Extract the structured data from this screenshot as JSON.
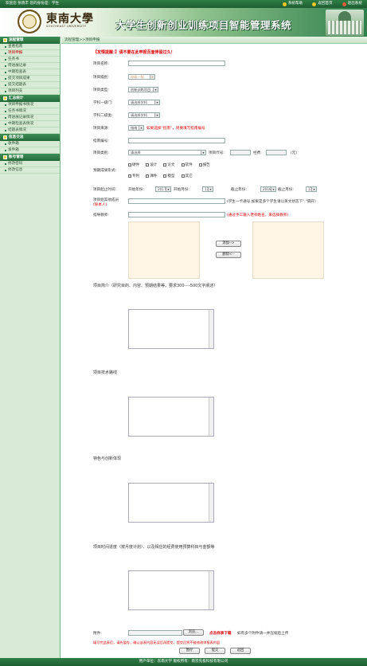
{
  "topbar": {
    "welcome": "欢迎您 张晓丰 您的身份是：学生",
    "links": [
      {
        "label": "系统帮助",
        "icon": "help-icon",
        "color": "#f3c623"
      },
      {
        "label": "返回首页",
        "icon": "home-icon",
        "color": "#f3c623"
      },
      {
        "label": "退出系统",
        "icon": "logout-icon",
        "color": "#f3c623"
      }
    ]
  },
  "banner": {
    "logo_text": "東南大學",
    "logo_sub": "SOUTHEAST UNIVERSITY",
    "title": "大学生创新创业训练项目智能管理系统"
  },
  "sidebar": {
    "sections": [
      {
        "title": "流程管理",
        "items": [
          "查看指南",
          "项目申报",
          "任务书",
          "周进展记录",
          "中期检查表",
          "提交项目成果",
          "提交结题表",
          "项目列支"
        ],
        "active": 1
      },
      {
        "title": "汇总统计",
        "items": [
          "项目申报书情况",
          "任务书情况",
          "周进展记录情况",
          "中期检查表情况",
          "结题表情况"
        ]
      },
      {
        "title": "信息交流",
        "items": [
          "收件箱",
          "发件箱"
        ]
      },
      {
        "title": "账号管理",
        "items": [
          "修改密码",
          "修改信息"
        ]
      }
    ]
  },
  "breadcrumb": "流程管理>>项目申报",
  "form": {
    "notice": "【友情提醒：】请不要在此申报页面停留过久！",
    "project_name_label": "项目名称:",
    "project_level_label": "项目级别:",
    "project_level_value": "校级一般",
    "project_type_label": "项目类型:",
    "project_type_value": "创新训练项目",
    "subject1_label": "学科一级门:",
    "subject1_value": "请选择学科",
    "subject2_label": "学科二级类:",
    "subject2_value": "请选择学科",
    "source_label": "项目来源:",
    "source_value": "指南",
    "source_hint": "如果选择“指南”，则要填写指南编号",
    "guide_no_label": "指南编号:",
    "category_label": "项目类别:",
    "category_value": "请选择",
    "code_label": "项目代号:",
    "fund_label": "经费:",
    "fund_unit": "（元）",
    "results_label": "预期成果形式:",
    "results_row1": [
      "硬件",
      "设计",
      "论文",
      "软件",
      "报告"
    ],
    "results_row2": [
      "专利",
      "课件",
      "模型",
      "其它"
    ],
    "period_label": "项目起止时间:",
    "start_year_label": "开始年份:",
    "start_year": "2017",
    "start_month_label": "开始月份:",
    "start_month": "11",
    "end_year_label": "截止年份:",
    "end_year": "2018",
    "end_month_label": "截止月份:",
    "end_month": "11",
    "members_label": "项目组其他成员",
    "members_sub": "(除本人)",
    "members_hint": "(学生一卡通号,如果是多个学生请以英文状态下\",\"隔开)",
    "advisor_label": "指导教师:",
    "advisor_hint": "(通过手工输入老师姓名，来选择教师)",
    "add_button": "添加-->",
    "delete_button": "删除<--",
    "intro_label": "项目简介（研究目的、内容、预期结果等，要求300----500文字阐述）",
    "tech_label": "项目技术路线",
    "feature_label": "特色与创新体现",
    "schedule_label": "项目时间进度（按月度计划）、以及相应的经费使用预算科目与金额等",
    "attach_label": "附件:",
    "browse_button": "浏览...",
    "template_link": "点击样表下载",
    "attach_hint": "如有多个附件请一并压缩后上传",
    "warning": "填写完此表后，请先暂存，确认该表内容无误后再提交，提交后将不能修改申报表内容",
    "save_button": "暂存",
    "submit_button": "提交",
    "back_button": "返回"
  },
  "footer": "用户单位：东南大学    版权所有：南京先极科技有限公司"
}
